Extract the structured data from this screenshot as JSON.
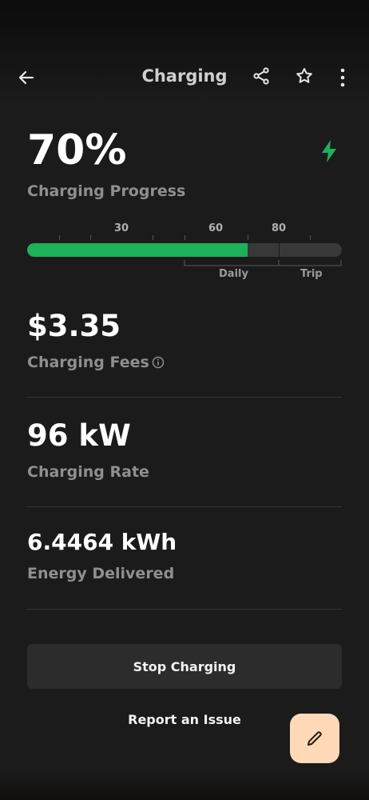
{
  "header": {
    "title": "Charging",
    "icons": {
      "back": "arrow-left-icon",
      "share": "share-icon",
      "favorite": "star-icon",
      "more": "more-vertical-icon"
    }
  },
  "progress": {
    "percent_label": "70%",
    "label": "Charging Progress",
    "status_icon": "lightning-bolt-icon",
    "value_percent": 70,
    "scale_labels": [
      "30",
      "60",
      "80"
    ],
    "range_labels": [
      "Daily",
      "Trip"
    ],
    "bar_color": "#1db15a"
  },
  "fees": {
    "value": "$3.35",
    "label": "Charging Fees",
    "info_icon": "info-icon"
  },
  "rate": {
    "value": "96 kW",
    "label": "Charging Rate"
  },
  "energy": {
    "value": "6.4464 kWh",
    "label": "Energy Delivered"
  },
  "actions": {
    "stop_label": "Stop Charging",
    "report_label": "Report an Issue",
    "fab_icon": "pencil-icon",
    "fab_color": "#ffd9b8"
  }
}
